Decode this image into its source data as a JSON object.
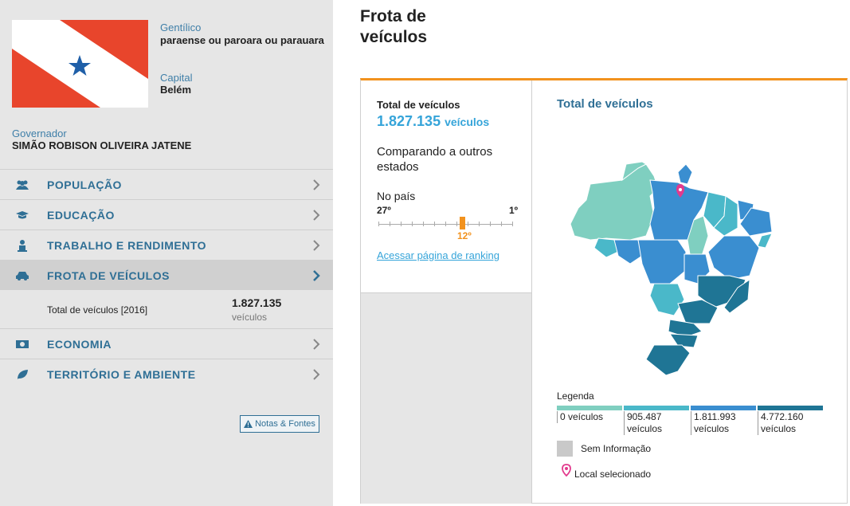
{
  "sidebar": {
    "gentilico_label": "Gentílico",
    "gentilico_value": "paraense ou paroara ou parauara",
    "capital_label": "Capital",
    "capital_value": "Belém",
    "governador_label": "Governador",
    "governador_value": "SIMÃO ROBISON OLIVEIRA JATENE",
    "menu": [
      {
        "label": "POPULAÇÃO",
        "icon": "people-icon"
      },
      {
        "label": "EDUCAÇÃO",
        "icon": "graduation-cap-icon"
      },
      {
        "label": "TRABALHO E RENDIMENTO",
        "icon": "worker-icon"
      },
      {
        "label": "FROTA DE VEÍCULOS",
        "icon": "car-icon"
      },
      {
        "label": "ECONOMIA",
        "icon": "money-icon"
      },
      {
        "label": "TERRITÓRIO E AMBIENTE",
        "icon": "leaf-icon"
      }
    ],
    "sub": {
      "label": "Total de veículos [2016]",
      "value": "1.827.135",
      "unit": "veículos"
    },
    "notes_label": "Notas & Fontes"
  },
  "main": {
    "title_line1": "Frota de",
    "title_line2": "veículos",
    "total_label": "Total de veículos",
    "total_value": "1.827.135",
    "total_unit": "veículos",
    "compare_text": "Comparando a outros estados",
    "no_pais": "No país",
    "rank_left": "27º",
    "rank_right": "1º",
    "rank_pos": "12º",
    "rank_link": "Acessar página de ranking",
    "map_title": "Total de veículos",
    "legend": {
      "title": "Legenda",
      "items": [
        {
          "value": "0 veículos",
          "color": "#7fcfc0"
        },
        {
          "value": "905.487 veículos",
          "color": "#4ab8c9"
        },
        {
          "value": "1.811.993 veículos",
          "color": "#3a8ed0"
        },
        {
          "value": "4.772.160 veículos",
          "color": "#1f7595"
        }
      ],
      "no_info": "Sem Informação",
      "selected": "Local selecionado"
    }
  },
  "colors": {
    "accent": "#f2921e",
    "link": "#35a4d9",
    "nav": "#2f6f95",
    "flag_red": "#e8452c",
    "flag_star": "#1f5fa8"
  }
}
